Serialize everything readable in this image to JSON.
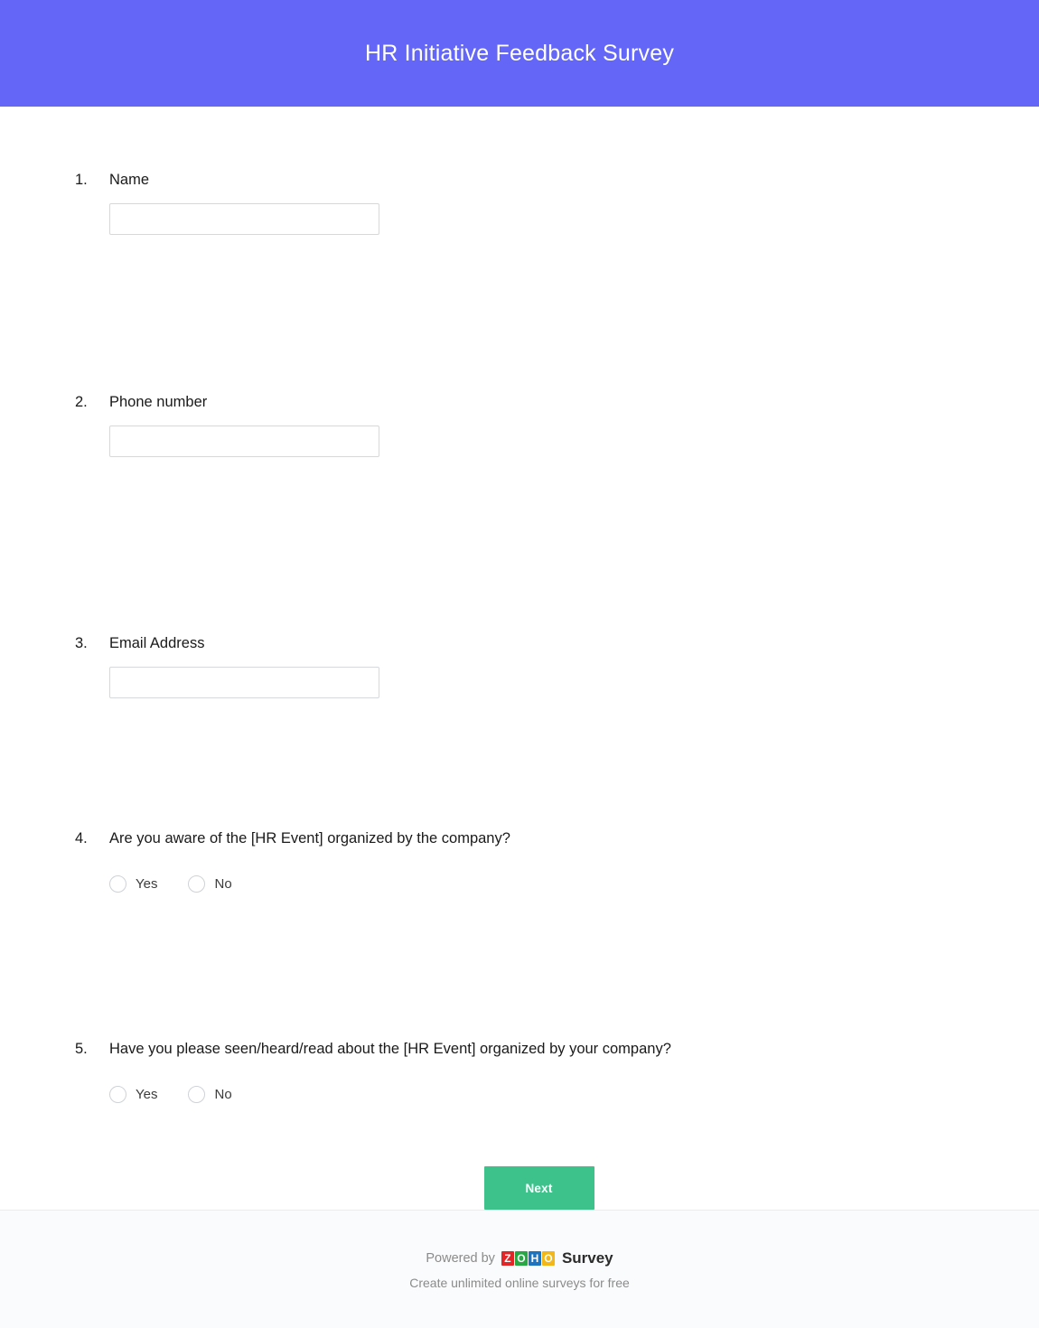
{
  "header": {
    "title": "HR Initiative Feedback Survey",
    "background_color": "#6366f7",
    "title_color": "#ffffff"
  },
  "questions": [
    {
      "number": "1.",
      "text": "Name",
      "type": "text",
      "value": "",
      "placeholder": ""
    },
    {
      "number": "2.",
      "text": "Phone number",
      "type": "text",
      "value": "",
      "placeholder": ""
    },
    {
      "number": "3.",
      "text": "Email Address",
      "type": "text",
      "value": "",
      "placeholder": ""
    },
    {
      "number": "4.",
      "text": "Are you aware of the [HR Event] organized by the company?",
      "type": "radio",
      "options": [
        {
          "label": "Yes",
          "selected": false
        },
        {
          "label": "No",
          "selected": false
        }
      ]
    },
    {
      "number": "5.",
      "text": "Have you please seen/heard/read about the [HR Event] organized by your company?",
      "type": "radio",
      "options": [
        {
          "label": "Yes",
          "selected": false
        },
        {
          "label": "No",
          "selected": false
        }
      ]
    }
  ],
  "actions": {
    "next_label": "Next",
    "next_color": "#3dc28b"
  },
  "footer": {
    "powered_by": "Powered by",
    "brand_letters": [
      "Z",
      "O",
      "H",
      "O"
    ],
    "brand_colors": [
      "#e42527",
      "#28a745",
      "#1e73be",
      "#f3b718"
    ],
    "product_name": "Survey",
    "tagline": "Create unlimited online surveys for free"
  }
}
